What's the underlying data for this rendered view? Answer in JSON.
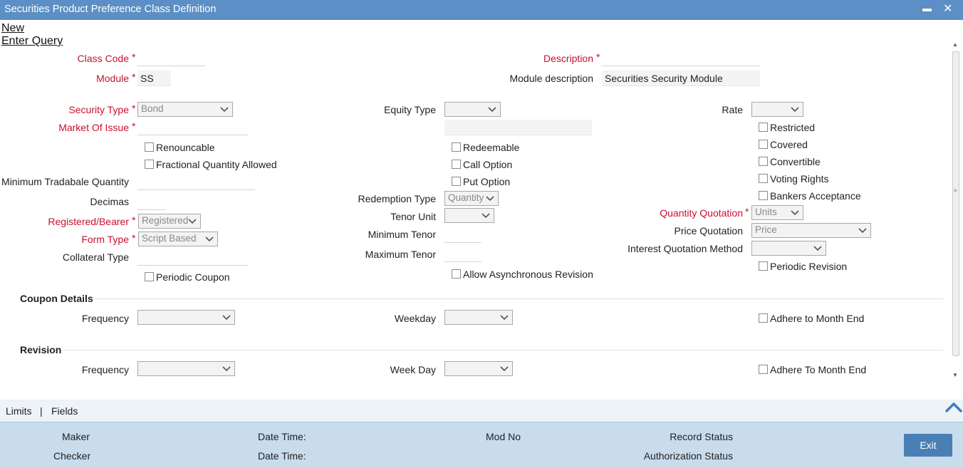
{
  "window": {
    "title": "Securities Product Preference Class Definition",
    "minimize_glyph": "▬",
    "close_glyph": "✕"
  },
  "menu": {
    "new": "New",
    "enter_query": "Enter Query"
  },
  "header": {
    "class_code_label": "Class Code",
    "class_code_value": "",
    "description_label": "Description",
    "description_value": "",
    "module_label": "Module",
    "module_value": "SS",
    "module_desc_label": "Module description",
    "module_desc_value": "Securities Security Module"
  },
  "col1": {
    "security_type_label": "Security Type",
    "security_type_value": "Bond",
    "market_of_issue_label": "Market Of Issue",
    "market_of_issue_value": "",
    "renouncable": "Renouncable",
    "fractional_qty": "Fractional Quantity Allowed",
    "min_tradable_qty_label": "Minimum Tradabale Quantity",
    "decimals_label": "Decimas",
    "registered_bearer_label": "Registered/Bearer",
    "registered_bearer_value": "Registered",
    "form_type_label": "Form Type",
    "form_type_value": "Script Based",
    "collateral_type_label": "Collateral Type",
    "periodic_coupon": "Periodic Coupon"
  },
  "col2": {
    "equity_type_label": "Equity Type",
    "equity_type_value": "",
    "redeemable": "Redeemable",
    "call_option": "Call Option",
    "put_option": "Put Option",
    "redemption_type_label": "Redemption Type",
    "redemption_type_value": "Quantity",
    "tenor_unit_label": "Tenor Unit",
    "tenor_unit_value": "",
    "min_tenor_label": "Minimum Tenor",
    "max_tenor_label": "Maximum Tenor",
    "allow_async_revision": "Allow Asynchronous Revision"
  },
  "col3": {
    "rate_label": "Rate",
    "rate_value": "",
    "restricted": "Restricted",
    "covered": "Covered",
    "convertible": "Convertible",
    "voting_rights": "Voting Rights",
    "bankers_acceptance": "Bankers Acceptance",
    "qty_quotation_label": "Quantity Quotation",
    "qty_quotation_value": "Units",
    "price_quotation_label": "Price Quotation",
    "price_quotation_value": "Price",
    "interest_quotation_label": "Interest Quotation Method",
    "interest_quotation_value": "",
    "periodic_revision": "Periodic Revision"
  },
  "coupon": {
    "title": "Coupon Details",
    "frequency_label": "Frequency",
    "frequency_value": "",
    "weekday_label": "Weekday",
    "weekday_value": "",
    "adhere_month_end": "Adhere to Month End"
  },
  "revision": {
    "title": "Revision",
    "frequency_label": "Frequency",
    "frequency_value": "",
    "weekday_label": "Week Day",
    "weekday_value": "",
    "adhere_month_end": "Adhere To Month End"
  },
  "tabs": {
    "limits": "Limits",
    "separator": "|",
    "fields": "Fields"
  },
  "footer": {
    "maker": "Maker",
    "maker_datetime": "Date Time:",
    "mod_no": "Mod No",
    "record_status": "Record Status",
    "checker": "Checker",
    "checker_datetime": "Date Time:",
    "authorization_status": "Authorization Status",
    "exit": "Exit"
  },
  "required_mark": "*",
  "colors": {
    "titlebar": "#5b8fc5",
    "required": "#c8102e",
    "footer": "#c8dcec",
    "exit_button": "#4a7fb5"
  },
  "icons": [
    "minimize-icon",
    "close-icon",
    "chevron-down-icon",
    "scroll-up-icon"
  ]
}
